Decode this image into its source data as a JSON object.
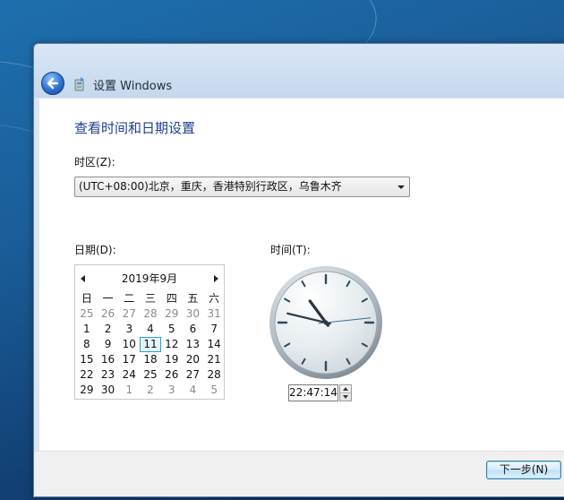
{
  "window": {
    "title": "设置 Windows"
  },
  "page": {
    "heading": "查看时间和日期设置",
    "timezone_label": "时区(Z):",
    "timezone_value": "(UTC+08:00)北京，重庆，香港特别行政区，乌鲁木齐",
    "date_label": "日期(D):",
    "time_label": "时间(T):"
  },
  "calendar": {
    "month_title": "2019年9月",
    "weekdays": [
      "日",
      "一",
      "二",
      "三",
      "四",
      "五",
      "六"
    ],
    "days": [
      "25",
      "26",
      "27",
      "28",
      "29",
      "30",
      "31",
      "1",
      "2",
      "3",
      "4",
      "5",
      "6",
      "7",
      "8",
      "9",
      "10",
      "11",
      "12",
      "13",
      "14",
      "15",
      "16",
      "17",
      "18",
      "19",
      "20",
      "21",
      "22",
      "23",
      "24",
      "25",
      "26",
      "27",
      "28",
      "29",
      "30",
      "1",
      "2",
      "3",
      "4",
      "5"
    ],
    "other_month_indices": [
      0,
      1,
      2,
      3,
      4,
      5,
      6,
      37,
      38,
      39,
      40,
      41
    ],
    "selected_index": 17
  },
  "clock": {
    "hour": 22,
    "minute": 47,
    "second": 14,
    "time_text": "22:47:14"
  },
  "footer": {
    "next_label": "下一步(N)"
  },
  "colors": {
    "heading": "#1e3f8f",
    "accent": "#26a0da",
    "desktop": "#1a5d98"
  },
  "icons": {
    "back": "back-arrow-icon",
    "app": "setup-app-icon",
    "dropdown": "chevron-down-icon"
  }
}
